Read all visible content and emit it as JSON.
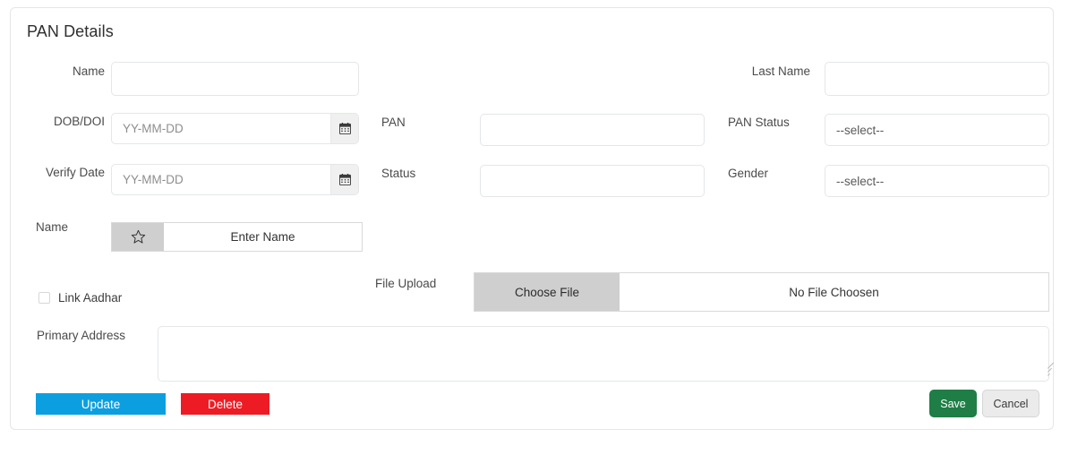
{
  "card": {
    "title": "PAN Details"
  },
  "fields": {
    "name": {
      "label": "Name",
      "value": "",
      "placeholder": ""
    },
    "last_name": {
      "label": "Last Name",
      "value": "",
      "placeholder": ""
    },
    "dob_doi": {
      "label": "DOB/DOI",
      "value": "",
      "placeholder": "YY-MM-DD",
      "addon_icon": "calendar-icon",
      "addon_glyph": "📅"
    },
    "pan": {
      "label": "PAN",
      "value": "",
      "placeholder": ""
    },
    "pan_status": {
      "label": "PAN Status",
      "selected": "--select--"
    },
    "verify_date": {
      "label": "Verify Date",
      "value": "",
      "placeholder": "YY-MM-DD",
      "addon_icon": "calendar-icon",
      "addon_glyph": "📅"
    },
    "status": {
      "label": "Status",
      "value": "",
      "placeholder": ""
    },
    "gender": {
      "label": "Gender",
      "selected": "--select--"
    },
    "name_entry": {
      "label": "Name",
      "addon_icon": "star-outline-icon",
      "addon_glyph": "☆",
      "text": "Enter Name"
    },
    "link_aadhar": {
      "label": "Link Aadhar",
      "checked": false
    },
    "file_upload": {
      "label": "File Upload",
      "button_label": "Choose File",
      "file_name": "No File Choosen"
    },
    "primary_address": {
      "label": "Primary Address",
      "value": "",
      "placeholder": ""
    }
  },
  "buttons": {
    "update": "Update",
    "delete": "Delete",
    "save": "Save",
    "cancel": "Cancel"
  },
  "colors": {
    "update": "#0c9fe0",
    "delete": "#ed1c24",
    "save": "#1e7e45",
    "cancel": "#ebebeb",
    "addon_grey": "#cfcfcf"
  }
}
